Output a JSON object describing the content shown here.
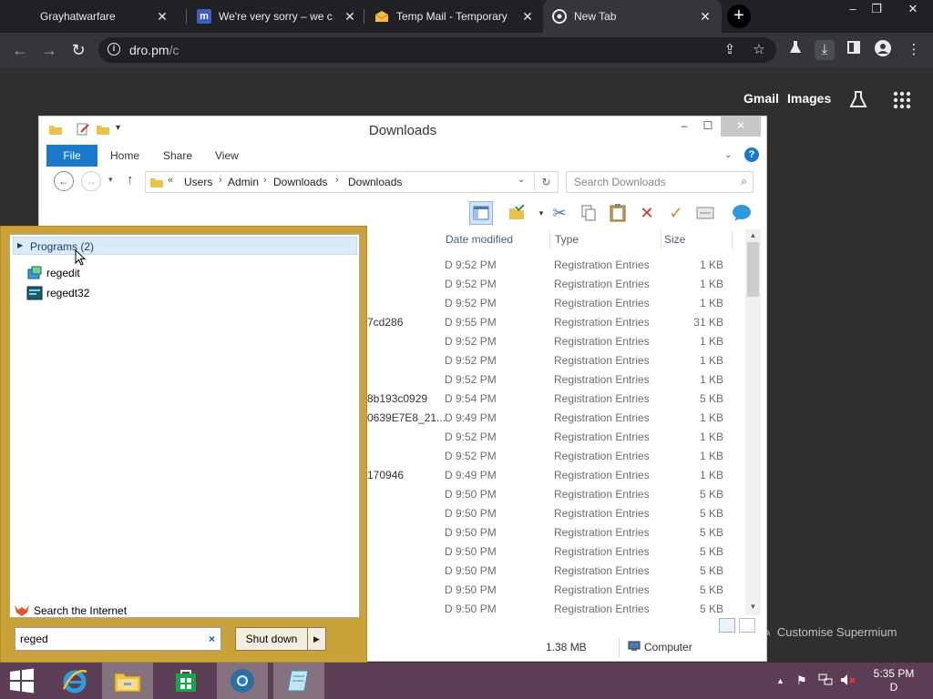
{
  "browser": {
    "tabs": [
      {
        "title": "Grayhatwarfare",
        "icon": "grayhatwarfare-favicon",
        "active": false
      },
      {
        "title": "We're very sorry – we c",
        "icon": "m-favicon",
        "active": false
      },
      {
        "title": "Temp Mail - Temporary",
        "icon": "tempmail-favicon",
        "active": false
      },
      {
        "title": "New Tab",
        "icon": "chrome-icon",
        "active": true
      }
    ],
    "url_host": "dro.pm",
    "url_path": "/c",
    "window_controls": {
      "minimize": "–",
      "restore": "❐",
      "close": "✕"
    }
  },
  "ntp": {
    "links": [
      "Gmail",
      "Images"
    ],
    "customise_label": "Customise Supermium"
  },
  "explorer": {
    "title": "Downloads",
    "ribbon_tabs": [
      "File",
      "Home",
      "Share",
      "View"
    ],
    "breadcrumb": [
      "Users",
      "Admin",
      "Downloads",
      "Downloads"
    ],
    "search_placeholder": "Search Downloads",
    "columns": [
      "Date modified",
      "Type",
      "Size"
    ],
    "rows": [
      {
        "name": "",
        "date": "D 9:52 PM",
        "type": "Registration Entries",
        "size": "1 KB"
      },
      {
        "name": "",
        "date": "D 9:52 PM",
        "type": "Registration Entries",
        "size": "1 KB"
      },
      {
        "name": "",
        "date": "D 9:52 PM",
        "type": "Registration Entries",
        "size": "1 KB"
      },
      {
        "name": "7cd286",
        "date": "D 9:55 PM",
        "type": "Registration Entries",
        "size": "31 KB"
      },
      {
        "name": "",
        "date": "D 9:52 PM",
        "type": "Registration Entries",
        "size": "1 KB"
      },
      {
        "name": "",
        "date": "D 9:52 PM",
        "type": "Registration Entries",
        "size": "1 KB"
      },
      {
        "name": "",
        "date": "D 9:52 PM",
        "type": "Registration Entries",
        "size": "1 KB"
      },
      {
        "name": "8b193c0929",
        "date": "D 9:54 PM",
        "type": "Registration Entries",
        "size": "5 KB"
      },
      {
        "name": "0639E7E8_21...",
        "date": "D 9:49 PM",
        "type": "Registration Entries",
        "size": "1 KB"
      },
      {
        "name": "",
        "date": "D 9:52 PM",
        "type": "Registration Entries",
        "size": "1 KB"
      },
      {
        "name": "",
        "date": "D 9:52 PM",
        "type": "Registration Entries",
        "size": "1 KB"
      },
      {
        "name": "170946",
        "date": "D 9:49 PM",
        "type": "Registration Entries",
        "size": "1 KB"
      },
      {
        "name": "",
        "date": "D 9:50 PM",
        "type": "Registration Entries",
        "size": "5 KB"
      },
      {
        "name": "",
        "date": "D 9:50 PM",
        "type": "Registration Entries",
        "size": "5 KB"
      },
      {
        "name": "",
        "date": "D 9:50 PM",
        "type": "Registration Entries",
        "size": "5 KB"
      },
      {
        "name": "",
        "date": "D 9:50 PM",
        "type": "Registration Entries",
        "size": "5 KB"
      },
      {
        "name": "",
        "date": "D 9:50 PM",
        "type": "Registration Entries",
        "size": "5 KB"
      },
      {
        "name": "",
        "date": "D 9:50 PM",
        "type": "Registration Entries",
        "size": "5 KB"
      },
      {
        "name": "",
        "date": "D 9:50 PM",
        "type": "Registration Entries",
        "size": "5 KB"
      }
    ],
    "status_size": "1.38 MB",
    "status_location": "Computer"
  },
  "startmenu": {
    "programs_header": "Programs (2)",
    "programs": [
      {
        "label": "regedit",
        "icon": "regedit-icon"
      },
      {
        "label": "regedt32",
        "icon": "regedt32-icon"
      }
    ],
    "search_internet_label": "Search the Internet",
    "search_value": "reged",
    "clear_glyph": "×",
    "shutdown_label": "Shut down"
  },
  "taskbar": {
    "apps": [
      "start-button",
      "internet-explorer",
      "file-explorer",
      "store",
      "chromium-browser",
      "notepad"
    ],
    "time": "5:35 PM",
    "date": "D"
  },
  "colors": {
    "accent_blue": "#1979ca",
    "taskbar": "#5b3e55",
    "startmenu_frame": "#c9a33a",
    "browser_dark": "#202124"
  }
}
